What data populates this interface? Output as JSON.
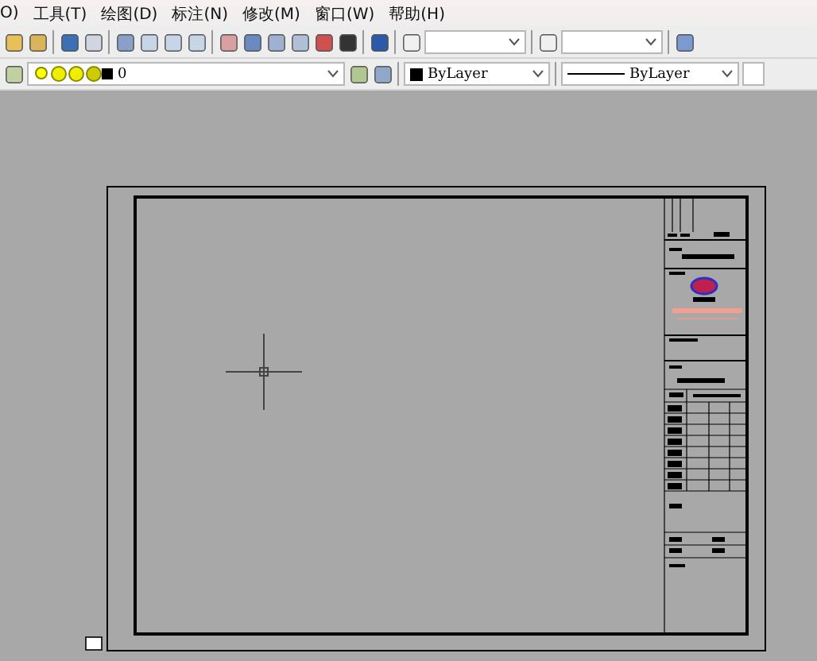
{
  "menu": [
    {
      "label": "O)"
    },
    {
      "label": "工具(T)"
    },
    {
      "label": "绘图(D)"
    },
    {
      "label": "标注(N)"
    },
    {
      "label": "修改(M)"
    },
    {
      "label": "窗口(W)"
    },
    {
      "label": "帮助(H)"
    }
  ],
  "layers_toolbar": {
    "layer": "0",
    "color_setting": "ByLayer",
    "linetype": "ByLayer"
  }
}
